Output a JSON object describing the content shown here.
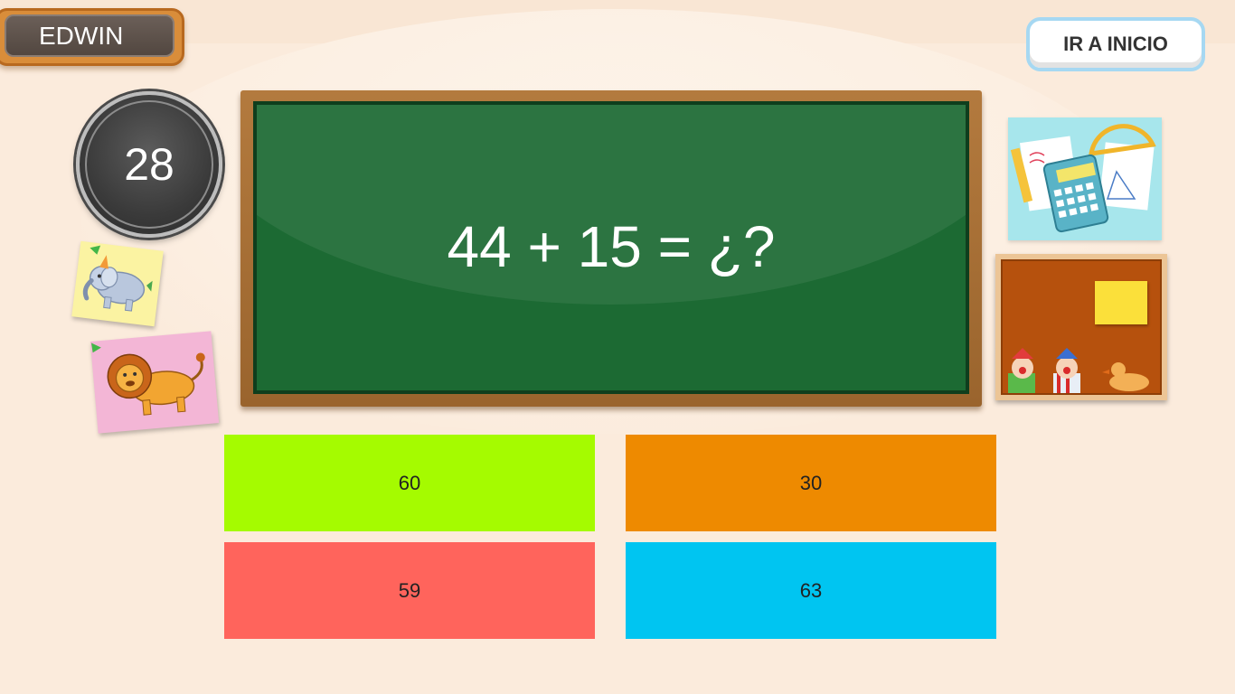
{
  "player": {
    "name": "EDWIN"
  },
  "nav": {
    "home_label": "IR A INICIO"
  },
  "timer": {
    "seconds": "28"
  },
  "question": {
    "text": "44 + 15 = ¿?"
  },
  "answers": [
    {
      "label": "60",
      "color": "#a5fb00"
    },
    {
      "label": "30",
      "color": "#ee8a00"
    },
    {
      "label": "59",
      "color": "#ff645c"
    },
    {
      "label": "63",
      "color": "#00c5f1"
    }
  ],
  "decorations": {
    "left_notes": [
      "elephant-icon",
      "lion-icon"
    ],
    "right_images": [
      "calculator-math-icon",
      "cork-board-toys-icon"
    ]
  },
  "colors": {
    "background": "#fbebdc",
    "chalkboard": "#1c6a33",
    "frame": "#a86e34"
  }
}
